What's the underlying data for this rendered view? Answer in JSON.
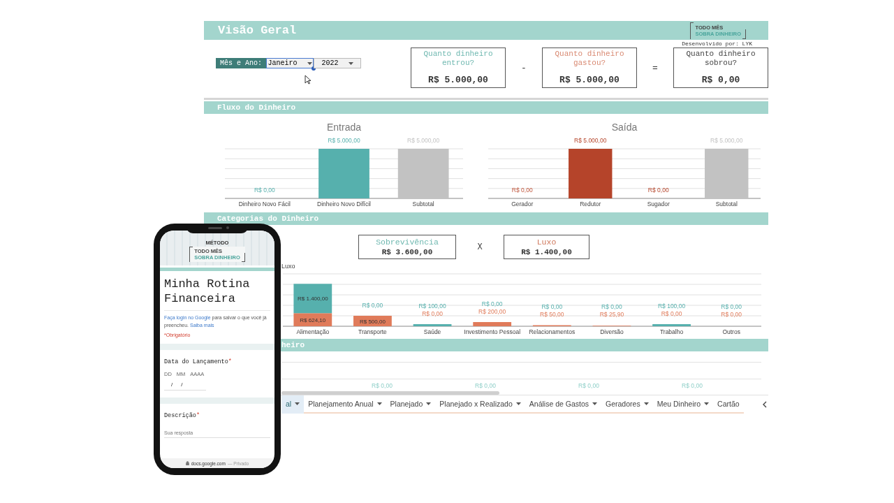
{
  "header": {
    "title": "Visão Geral",
    "logo": {
      "line_1": "TODO MÊS",
      "line_2": "SOBRA DINHEIRO"
    },
    "credit": "Desenvolvido por: LYK",
    "selector": {
      "label": "Mês e Ano:",
      "fields": [
        {
          "value": "Janeiro",
          "selected": true
        },
        {
          "value": "2022",
          "selected": false
        }
      ]
    },
    "cards": [
      {
        "question": "Quanto dinheiro entrou?",
        "amount": "R$ 5.000,00",
        "color": "#6fb8b0"
      },
      {
        "question": "Quanto dinheiro gastou?",
        "amount": "R$ 5.000,00",
        "color": "#d98a73"
      },
      {
        "question": "Quanto dinheiro sobrou?",
        "amount": "R$ 0,00",
        "color": "#444444"
      }
    ],
    "operators": [
      "-",
      "="
    ]
  },
  "fluxo": {
    "title": "Fluxo do Dinheiro",
    "charts": [
      {
        "chart_data": {
          "type": "bar",
          "title": "Entrada",
          "data_labels": true,
          "categories": [
            "Dinheiro Novo Fácil",
            "Dinheiro Novo Difícil",
            "Subtotal"
          ],
          "values": [
            0,
            5000,
            5000
          ],
          "colors": [
            "#56b0ad",
            "#56b0ad",
            "#c2c2c2"
          ],
          "value_labels": [
            "R$ 0,00",
            "R$ 5.000,00",
            "R$ 5.000,00"
          ]
        }
      },
      {
        "chart_data": {
          "type": "bar",
          "title": "Saída",
          "data_labels": true,
          "categories": [
            "Gerador",
            "Redutor",
            "Sugador",
            "Subtotal"
          ],
          "values": [
            0,
            5000,
            0,
            5000
          ],
          "colors": [
            "#c0563d",
            "#b5442a",
            "#b5442a",
            "#c2c2c2"
          ],
          "value_labels": [
            "R$ 0,00",
            "R$ 5.000,00",
            "R$ 0,00",
            "R$ 5.000,00"
          ]
        }
      }
    ]
  },
  "categorias": {
    "title": "Categorias do Dinheiro",
    "cards": [
      {
        "label": "Sobrevivência",
        "amount": "R$ 3.600,00",
        "color": "#6fb8b0"
      },
      {
        "label": "Luxo",
        "amount": "R$ 1.400,00",
        "color": "#d07a5e"
      }
    ],
    "operator": "X",
    "chart_data": {
      "type": "bar",
      "stacked": true,
      "data_labels": true,
      "categories": [
        "Alimentação",
        "Transporte",
        "Saúde",
        "Investimento Pessoal",
        "Relacionamentos",
        "Diversão",
        "Trabalho",
        "Outros"
      ],
      "series": [
        {
          "color": "#e07b5a",
          "values": [
            624.1,
            500,
            0,
            200,
            50,
            25.9,
            0,
            0
          ],
          "value_labels": [
            "R$ 624,10",
            "R$ 500,00",
            "R$ 0,00",
            "R$ 200,00",
            "R$ 50,00",
            "R$ 25,90",
            "R$ 0,00",
            "R$ 0,00"
          ]
        },
        {
          "name": "Luxo",
          "color": "#56b0ad",
          "values": [
            1400,
            0,
            100,
            0,
            0,
            0,
            100,
            0
          ],
          "value_labels": [
            "R$ 1.400,00",
            "R$ 0,00",
            "R$ 100,00",
            "R$ 0,00",
            "R$ 0,00",
            "R$ 0,00",
            "R$ 100,00",
            "R$ 0,00"
          ]
        }
      ]
    }
  },
  "section_4": {
    "title": "heiro",
    "labels": [
      "R$ 0,00",
      "R$ 0,00",
      "R$ 0,00",
      "R$ 0,00"
    ]
  },
  "tabs": [
    {
      "label": "al",
      "selected": true,
      "kind": "menu"
    },
    {
      "label": "Planejamento Anual",
      "selected": false,
      "kind": "menu"
    },
    {
      "label": "Planejado",
      "selected": false,
      "kind": "menu"
    },
    {
      "label": "Planejado x Realizado",
      "selected": false,
      "kind": "menu"
    },
    {
      "label": "Análise de Gastos",
      "selected": false,
      "kind": "menu"
    },
    {
      "label": "Geradores",
      "selected": false,
      "kind": "menu"
    },
    {
      "label": "Meu Dinheiro",
      "selected": false,
      "kind": "menu"
    },
    {
      "label": "Cartão",
      "selected": false,
      "kind": "plain"
    }
  ],
  "phone": {
    "banner": {
      "method": "MÉTODO",
      "line_1": "TODO MÊS",
      "line_2": "SOBRA DINHEIRO"
    },
    "form_title": "Minha Rotina Financeira",
    "login_note": [
      {
        "text": "Faça login no Google",
        "kind": "link"
      },
      {
        "text": " para salvar o que você já preencheu. ",
        "kind": "plain"
      },
      {
        "text": "Saiba mais",
        "kind": "link"
      }
    ],
    "required_note": "*Obrigatório",
    "questions": [
      {
        "label": "Data do Lançamento",
        "required_mark": "*",
        "kind": "date",
        "parts": [
          "DD",
          "MM",
          "AAAA"
        ],
        "separators": [
          "/",
          "/"
        ]
      },
      {
        "label": "Descrição",
        "required_mark": "*",
        "kind": "text",
        "placeholder": "Sua resposta"
      }
    ],
    "url": "docs.google.com",
    "privacy": "— Privado"
  }
}
